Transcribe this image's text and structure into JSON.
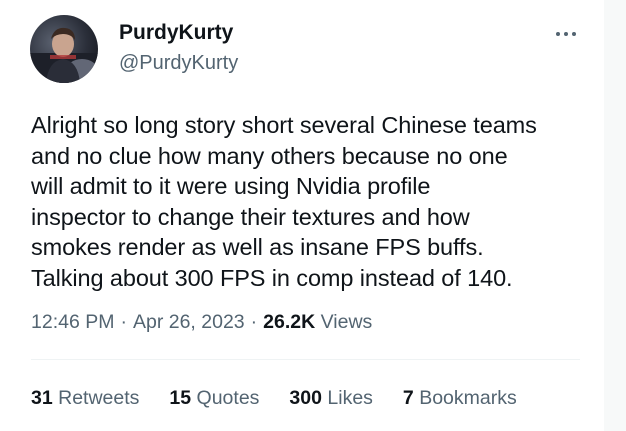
{
  "author": {
    "display_name": "PurdyKurty",
    "handle": "@PurdyKurty"
  },
  "tweet": {
    "text": "Alright so long story short several Chinese teams\nand no clue how many others because no one\nwill admit to it were using Nvidia profile\ninspector to change their textures and how\nsmokes render as well as insane FPS buffs.\nTalking about 300 FPS in comp instead of 140."
  },
  "meta": {
    "time": "12:46 PM",
    "date": "Apr 26, 2023",
    "views_count": "26.2K",
    "views_label": "Views",
    "separator": "·"
  },
  "stats": {
    "retweets": {
      "count": "31",
      "label": "Retweets"
    },
    "quotes": {
      "count": "15",
      "label": "Quotes"
    },
    "likes": {
      "count": "300",
      "label": "Likes"
    },
    "bookmarks": {
      "count": "7",
      "label": "Bookmarks"
    }
  },
  "icons": {
    "more": "more-horizontal-icon"
  },
  "colors": {
    "text_primary": "#0f1419",
    "text_secondary": "#536471",
    "divider": "#eff3f4"
  }
}
